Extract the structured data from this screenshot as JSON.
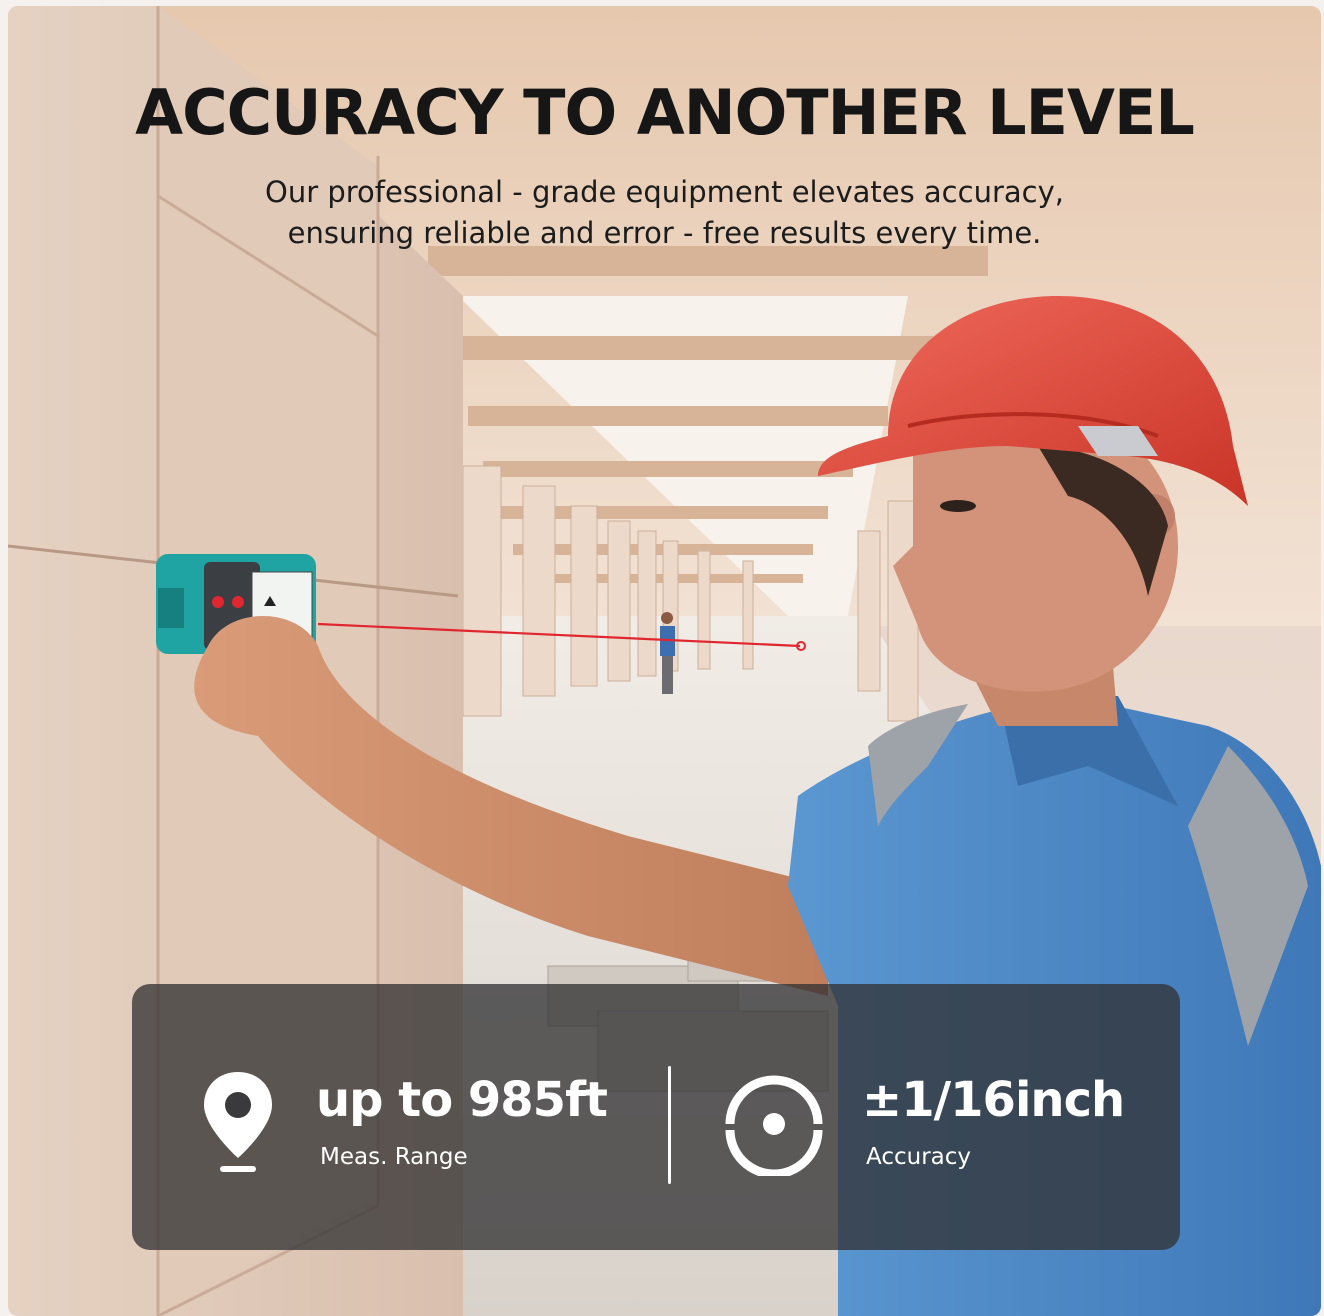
{
  "headline": "ACCURACY TO ANOTHER LEVEL",
  "subhead": {
    "line1": "Our professional - grade equipment elevates accuracy,",
    "line2": "ensuring reliable and error - free results every time."
  },
  "specs": [
    {
      "icon": "location-pin-icon",
      "value": "up to 985ft",
      "label": "Meas. Range"
    },
    {
      "icon": "target-icon",
      "value": "±1/16inch",
      "label": "Accuracy"
    }
  ],
  "colors": {
    "device": "#1fa3a3",
    "helmet": "#e2453a",
    "shirt": "#4a86c4",
    "laser": "#e0262f",
    "panel": "#303032"
  }
}
